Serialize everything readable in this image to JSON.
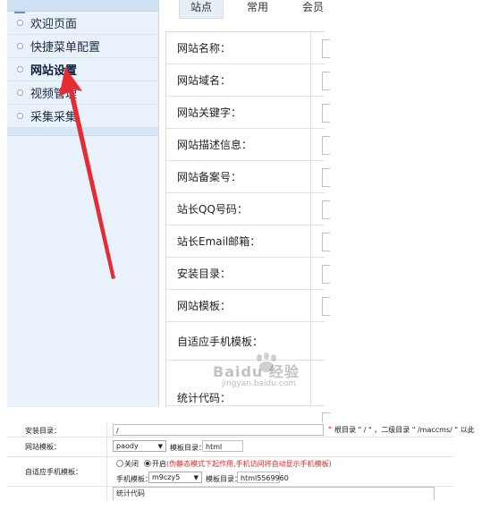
{
  "sidebar": {
    "items": [
      {
        "label": "欢迎页面"
      },
      {
        "label": "快捷菜单配置"
      },
      {
        "label": "网站设置"
      },
      {
        "label": "视频管理"
      },
      {
        "label": "采集采集"
      }
    ]
  },
  "tabs": [
    {
      "label": "站点"
    },
    {
      "label": "常用"
    },
    {
      "label": "会员"
    }
  ],
  "form": {
    "rows": [
      {
        "label": "网站名称："
      },
      {
        "label": "网站域名："
      },
      {
        "label": "网站关键字："
      },
      {
        "label": "网站描述信息："
      },
      {
        "label": "网站备案号："
      },
      {
        "label": "站长QQ号码："
      },
      {
        "label": "站长Email邮箱："
      },
      {
        "label": "安装目录："
      },
      {
        "label": "网站模板："
      },
      {
        "label": "自适应手机模板："
      },
      {
        "label": "统计代码："
      }
    ]
  },
  "watermark": {
    "brand": "Baidu 经验",
    "url": "jingyan.baidu.com"
  },
  "bottom": {
    "install_dir": {
      "label": "安装目录：",
      "value": "/",
      "hint_star": "*",
      "hint": "根目录 \" / \" ，二级目录 \" /maccms/ \" 以此"
    },
    "site_template": {
      "label": "网站模板：",
      "select_value": "paody",
      "dir_label": "模板目录：",
      "dir_value": "html"
    },
    "mobile_template": {
      "label": "自适应手机模板：",
      "off_label": "关闭",
      "on_label": "开启",
      "note": "(伪静态模式下起作用,手机访问将自动显示手机模板)",
      "mobile_label": "手机模板：",
      "select_value": "m9czy5",
      "dir_label": "模板目录：",
      "dir_value": "html5569960"
    },
    "stats": {
      "value": "统计代码"
    }
  },
  "colors": {
    "sidebar_bg": "#e9f1fb",
    "arrow": "#e52b33",
    "note_red": "#d42b2b"
  }
}
